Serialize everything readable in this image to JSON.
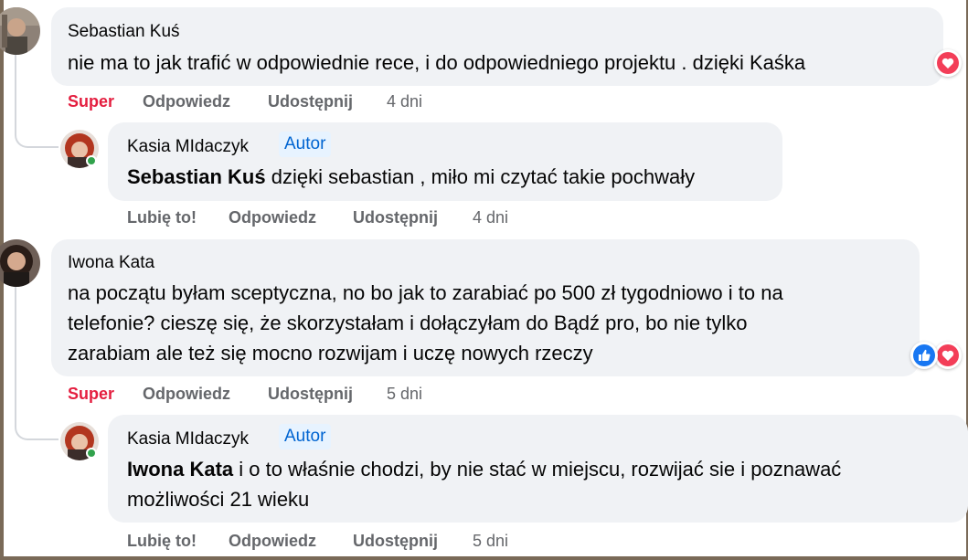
{
  "comments": [
    {
      "author": "Sebastian Kuś",
      "line1": "nie ma to jak trafić w odpowiednie rece, i do odpowiedniego projektu . dzięki Kaśka",
      "actions": {
        "react": "Super",
        "reply": "Odpowiedz",
        "share": "Udostępnij",
        "time": "4 dni"
      }
    },
    {
      "author": "Kasia MIdaczyk",
      "badge": "Autor",
      "mention": "Sebastian Kuś",
      "rest": " dzięki sebastian , miło mi czytać takie pochwały",
      "actions": {
        "react": "Lubię to!",
        "reply": "Odpowiedz",
        "share": "Udostępnij",
        "time": "4 dni"
      }
    },
    {
      "author": "Iwona Kata",
      "line1": "na początu byłam sceptyczna, no bo jak to zarabiać po 500 zł tygodniowo i to na",
      "line2": "telefonie? cieszę się, że skorzystałam i dołączyłam do Bądź pro, bo nie tylko",
      "line3": "zarabiam ale też się mocno rozwijam i uczę nowych rzeczy",
      "actions": {
        "react": "Super",
        "reply": "Odpowiedz",
        "share": "Udostępnij",
        "time": "5 dni"
      }
    },
    {
      "author": "Kasia MIdaczyk",
      "badge": "Autor",
      "mention": "Iwona Kata",
      "rest": " i o to właśnie chodzi, by nie stać w miejscu, rozwijać sie i poznawać",
      "line2": "możliwości 21 wieku",
      "actions": {
        "react": "Lubię to!",
        "reply": "Odpowiedz",
        "share": "Udostępnij",
        "time": "5 dni"
      }
    }
  ],
  "colors": {
    "bubble": "#f0f2f5",
    "secondary_text": "#65676b",
    "super_red": "#e41e3f",
    "author_badge_blue": "#0064d1",
    "like_blue": "#1877f2",
    "love_red": "#f33e58",
    "online_green": "#31a24c"
  },
  "icons": {
    "reaction_love": "heart-icon",
    "reaction_like": "thumbs-up-icon"
  }
}
